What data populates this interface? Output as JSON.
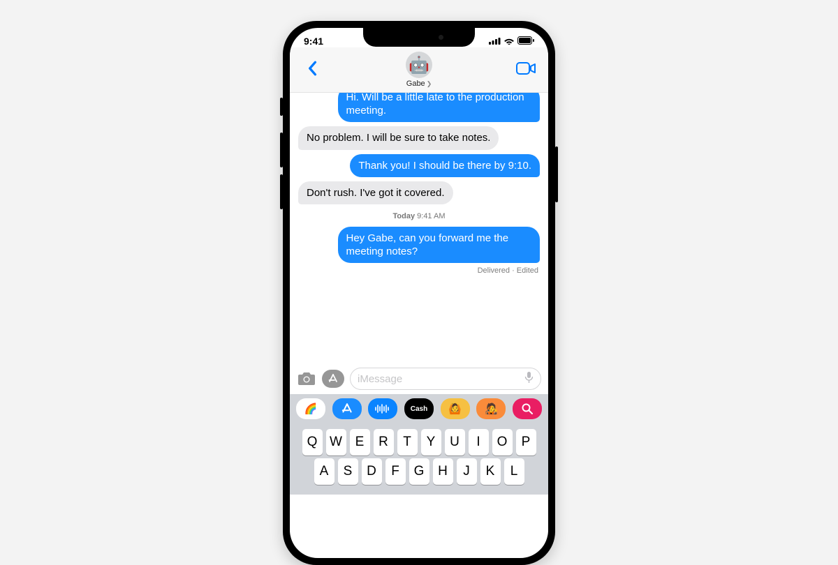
{
  "status": {
    "time": "9:41"
  },
  "header": {
    "contact_name": "Gabe",
    "avatar_emoji": "🤖"
  },
  "thread": {
    "messages": [
      {
        "side": "sent",
        "text": "Hi. Will be a little late to the production meeting."
      },
      {
        "side": "received",
        "text": "No problem. I will be sure to take notes."
      },
      {
        "side": "sent",
        "text": "Thank you! I should be there by 9:10."
      },
      {
        "side": "received",
        "text": "Don't rush. I've got it covered."
      }
    ],
    "timestamp_day": "Today",
    "timestamp_time": "9:41 AM",
    "last_message": {
      "side": "sent",
      "text": "Hey Gabe, can you forward me the meeting notes?"
    },
    "status_line": "Delivered · Edited"
  },
  "input": {
    "placeholder": "iMessage"
  },
  "app_strip": [
    {
      "name": "photos",
      "bg": "#ffffff",
      "emoji": "🌈"
    },
    {
      "name": "appstore",
      "bg": "#1a8cff",
      "svg": "appstore"
    },
    {
      "name": "audio",
      "bg": "#0a84ff",
      "svg": "wave"
    },
    {
      "name": "cash",
      "bg": "#000000",
      "label": "Cash"
    },
    {
      "name": "memoji1",
      "bg": "#f6c042",
      "emoji": "🙆"
    },
    {
      "name": "memoji2",
      "bg": "#fa8b3a",
      "emoji": "🧑‍🎤"
    },
    {
      "name": "search",
      "bg": "#e91e63",
      "svg": "search"
    }
  ],
  "keyboard": {
    "row1": [
      "Q",
      "W",
      "E",
      "R",
      "T",
      "Y",
      "U",
      "I",
      "O",
      "P"
    ],
    "row2": [
      "A",
      "S",
      "D",
      "F",
      "G",
      "H",
      "J",
      "K",
      "L"
    ]
  }
}
